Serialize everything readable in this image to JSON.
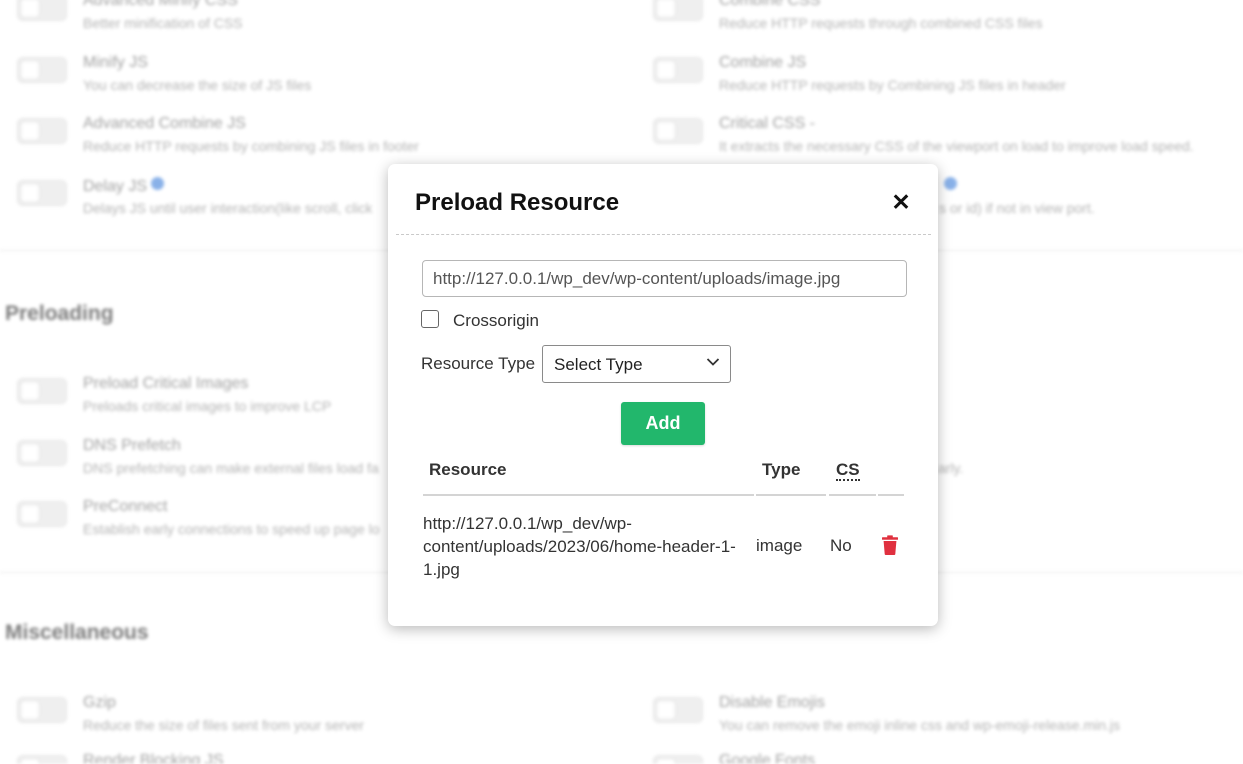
{
  "background": {
    "options": [
      {
        "title": "Advanced Minify CSS",
        "desc": "Better minification of CSS",
        "info": false
      },
      {
        "title": "Combine CSS",
        "desc": "Reduce HTTP requests through combined CSS files",
        "info": false
      },
      {
        "title": "Minify JS",
        "desc": "You can decrease the size of JS files",
        "info": false
      },
      {
        "title": "Combine JS",
        "desc": "Reduce HTTP requests by Combining JS files in header",
        "info": false
      },
      {
        "title": "Advanced Combine JS",
        "desc": "Reduce HTTP requests by combining JS files in footer",
        "info": false
      },
      {
        "title": "Critical CSS -",
        "desc": "It extracts the necessary CSS of the viewport on load to improve load speed.",
        "info": false
      },
      {
        "title": "Delay JS",
        "desc": "Delays JS until user interaction(like scroll, click",
        "info": true
      },
      {
        "title": "",
        "desc": "s or id) if not in view port.",
        "info": true
      },
      {
        "title": "Preload Critical Images",
        "desc": "Preloads critical images to improve LCP",
        "info": false
      },
      {
        "title": "DNS Prefetch",
        "desc": "DNS prefetching can make external files load fa",
        "info": false
      },
      {
        "title": "",
        "desc": "arly.",
        "info": false
      },
      {
        "title": "PreConnect",
        "desc": "Establish early connections to speed up page lo",
        "info": false
      },
      {
        "title": "Gzip",
        "desc": "Reduce the size of files sent from your server",
        "info": false
      },
      {
        "title": "Disable Emojis",
        "desc": "You can remove the emoji inline css and wp-emoji-release.min.js",
        "info": false
      },
      {
        "title": "Render Blocking JS",
        "desc": "",
        "info": false
      },
      {
        "title": "Google Fonts",
        "desc": "",
        "info": false
      }
    ],
    "sections": {
      "preloading": "Preloading",
      "miscellaneous": "Miscellaneous"
    }
  },
  "modal": {
    "title": "Preload Resource",
    "close_icon": "close-icon",
    "url_input_value": "http://127.0.0.1/wp_dev/wp-content/uploads/image.jpg",
    "crossorigin_label": "Crossorigin",
    "crossorigin_checked": false,
    "resource_type_label": "Resource Type",
    "resource_type_selected": "Select Type",
    "add_button_label": "Add",
    "accent_color": "#22b76c",
    "delete_color": "#e0303f",
    "table": {
      "headers": [
        "Resource",
        "Type",
        "CS",
        ""
      ],
      "rows": [
        {
          "resource": "http://127.0.0.1/wp_dev/wp-content/uploads/2023/06/home-header-1-1.jpg",
          "type": "image",
          "cs": "No",
          "action_icon": "trash-icon"
        }
      ]
    }
  }
}
